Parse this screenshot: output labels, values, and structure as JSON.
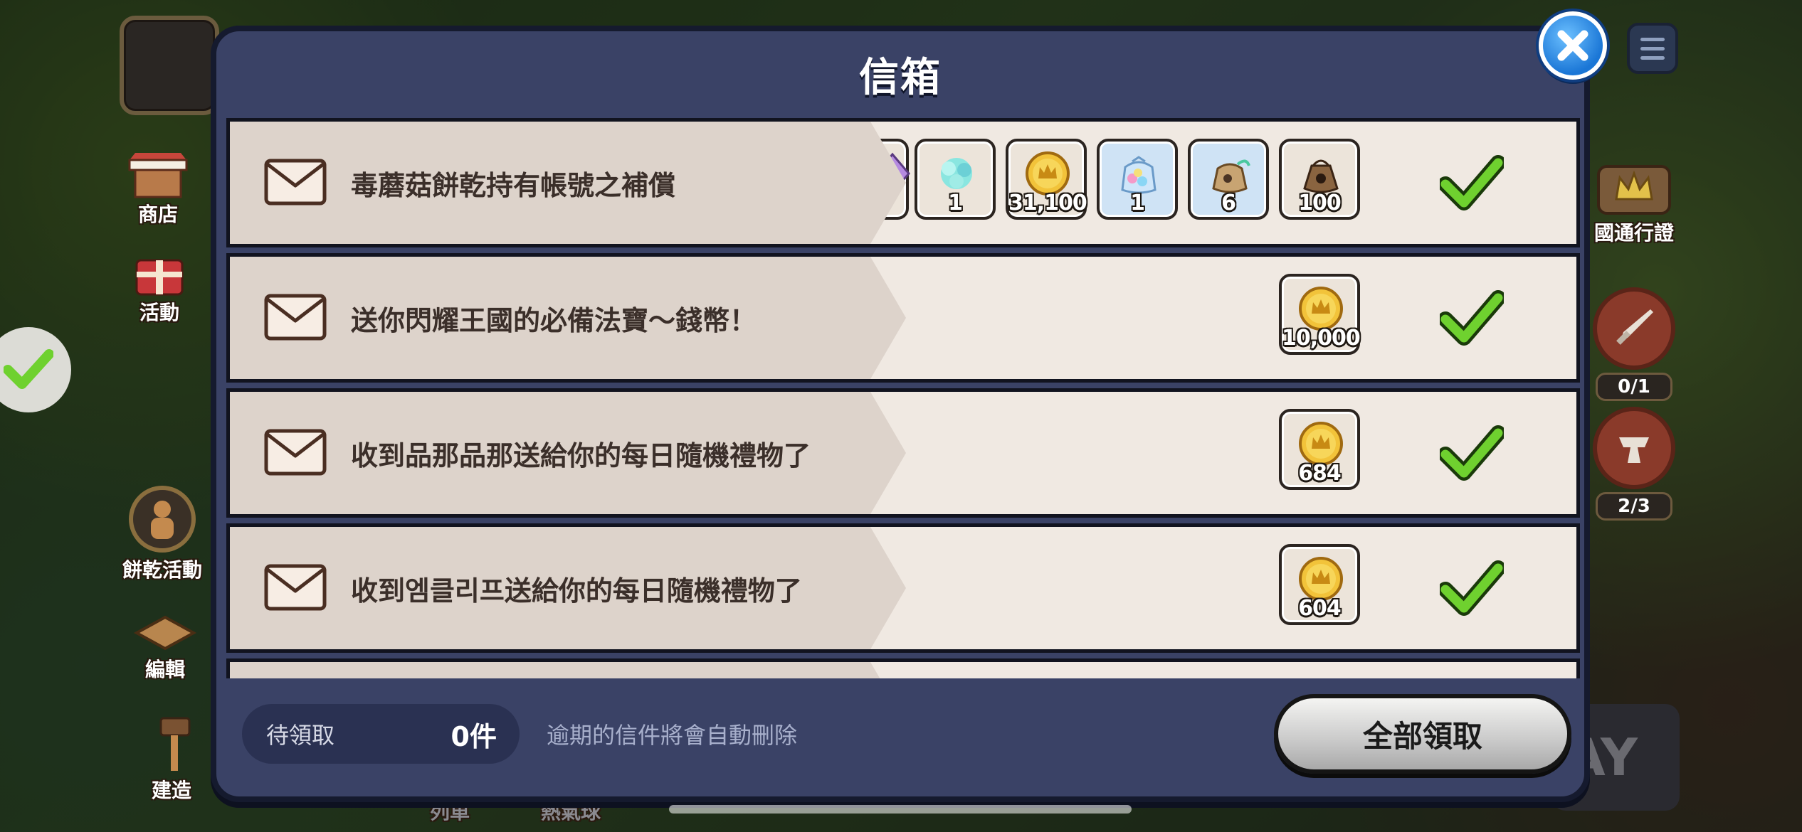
{
  "background": {
    "side_menu": [
      {
        "label": "商店",
        "icon": "shop-icon"
      },
      {
        "label": "活動",
        "icon": "gift-icon"
      },
      {
        "label": "餅乾活動",
        "icon": "cookie-icon"
      },
      {
        "label": "編輯",
        "icon": "edit-icon"
      },
      {
        "label": "建造",
        "icon": "build-icon"
      }
    ],
    "right_side": {
      "pass_label": "國通行證",
      "battle_count": "0/1",
      "workshop_count": "2/3"
    },
    "play_button": "AY",
    "bottom_labels": [
      "列車",
      "熱氣球"
    ]
  },
  "mailbox": {
    "title": "信箱",
    "mails": [
      {
        "title": "毒蘑菇餅乾持有帳號之補償",
        "rewards": [
          {
            "icon": "crystal-icon",
            "qty": "1"
          },
          {
            "icon": "coin-icon",
            "qty": "31,100"
          },
          {
            "icon": "candy-bag-icon",
            "qty": "1"
          },
          {
            "icon": "ingredient-sack-icon",
            "qty": "6"
          },
          {
            "icon": "ingredient-bag-icon",
            "qty": "100"
          }
        ]
      },
      {
        "title": "送你閃耀王國的必備法寶～錢幣！",
        "rewards": [
          {
            "icon": "coin-icon",
            "qty": "10,000"
          }
        ]
      },
      {
        "title": "收到品那品那送給你的每日隨機禮物了",
        "rewards": [
          {
            "icon": "coin-icon",
            "qty": "684"
          }
        ]
      },
      {
        "title": "收到엠클리프送給你的每日隨機禮物了",
        "rewards": [
          {
            "icon": "coin-icon",
            "qty": "604"
          }
        ]
      }
    ],
    "footer": {
      "pending_label": "待領取",
      "pending_count": "0件",
      "expire_note": "逾期的信件將會自動刪除",
      "claim_all": "全部領取"
    }
  },
  "colors": {
    "modal_bg": "#3a4266",
    "row_bg": "#f0e9e2",
    "check_green": "#6fd12f",
    "close_blue": "#1a76d6"
  }
}
